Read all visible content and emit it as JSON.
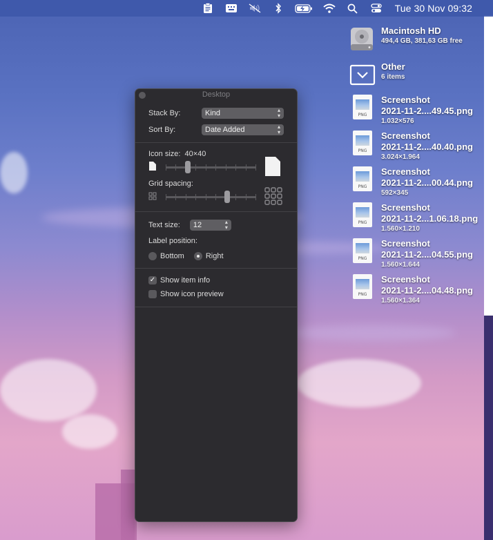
{
  "menubar": {
    "icons": [
      "clipboard-icon",
      "keyboard-icon",
      "mute-icon",
      "bluetooth-icon",
      "battery-charging-icon",
      "wifi-icon",
      "spotlight-search-icon",
      "control-center-icon"
    ],
    "clock": "Tue 30 Nov  09:32"
  },
  "desktop": {
    "drive": {
      "name": "Macintosh HD",
      "info": "494,4 GB, 381,63 GB free"
    },
    "folder": {
      "name": "Other",
      "info": "6 items"
    },
    "files": [
      {
        "line1": "Screenshot",
        "line2": "2021-11-2....49.45.png",
        "info": "1.032×576"
      },
      {
        "line1": "Screenshot",
        "line2": "2021-11-2....40.40.png",
        "info": "3.024×1.964"
      },
      {
        "line1": "Screenshot",
        "line2": "2021-11-2....00.44.png",
        "info": "592×345"
      },
      {
        "line1": "Screenshot",
        "line2": "2021-11-2...1.06.18.png",
        "info": "1.560×1.210"
      },
      {
        "line1": "Screenshot",
        "line2": "2021-11-2....04.55.png",
        "info": "1.560×1.644"
      },
      {
        "line1": "Screenshot",
        "line2": "2021-11-2....04.48.png",
        "info": "1.560×1.364"
      }
    ],
    "file_badge": "PNG"
  },
  "panel": {
    "title": "Desktop",
    "stack_by": {
      "label": "Stack By:",
      "value": "Kind"
    },
    "sort_by": {
      "label": "Sort By:",
      "value": "Date Added"
    },
    "icon_size": {
      "label": "Icon size:",
      "value": "40×40",
      "level": 0.23
    },
    "grid_spacing": {
      "label": "Grid spacing:",
      "level": 0.69
    },
    "text_size": {
      "label": "Text size:",
      "value": "12"
    },
    "label_position": {
      "label": "Label position:",
      "options": [
        "Bottom",
        "Right"
      ],
      "selected": "Right"
    },
    "show_item_info": {
      "label": "Show item info",
      "checked": true
    },
    "show_icon_preview": {
      "label": "Show icon preview",
      "checked": false
    }
  }
}
